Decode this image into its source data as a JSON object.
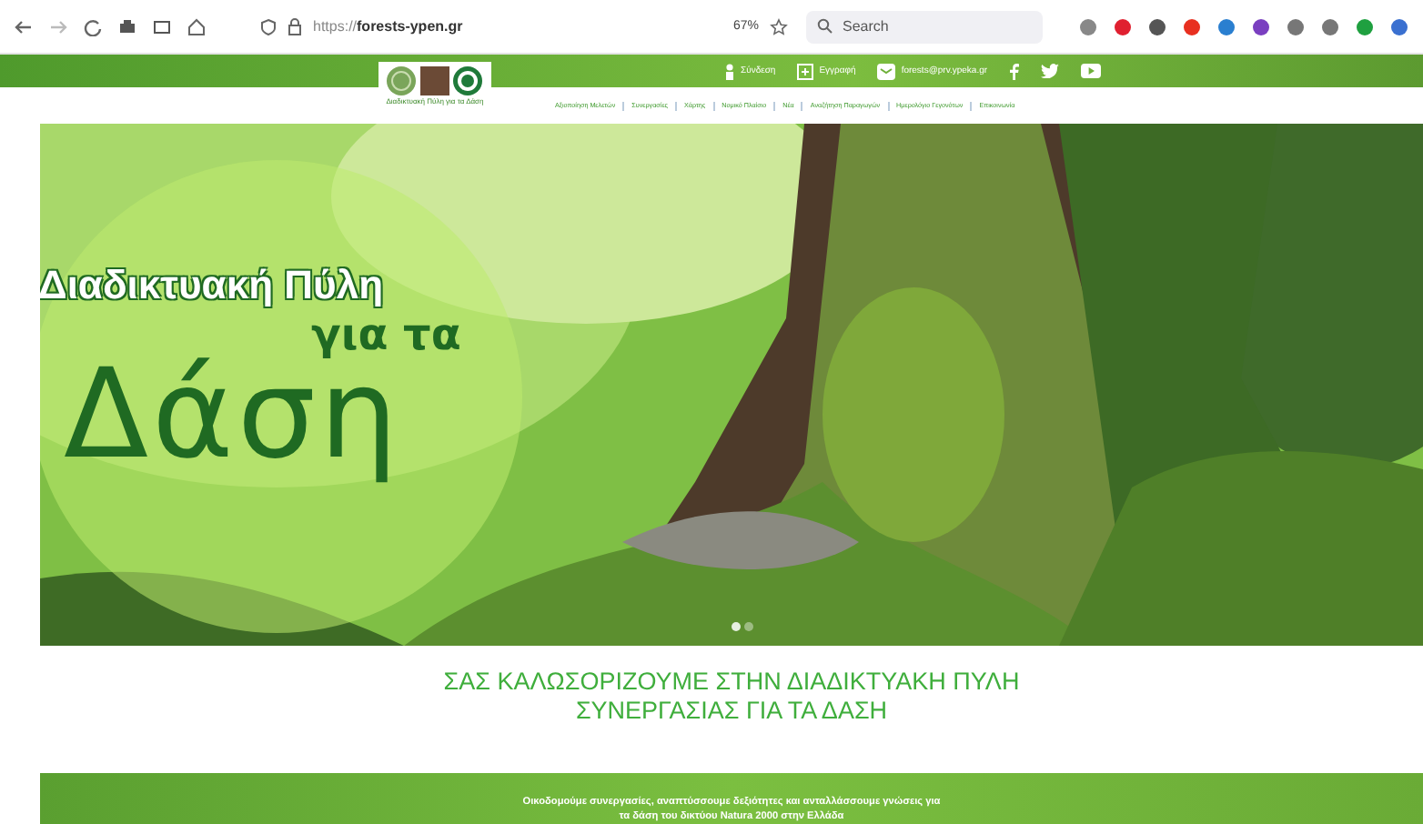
{
  "browser": {
    "url_prefix": "https://",
    "url_host": "forests-ypen.gr",
    "zoom": "67%",
    "search_placeholder": "Search"
  },
  "top_bar": {
    "links": [
      {
        "kind": "user",
        "label": "Σύνδεση"
      },
      {
        "kind": "plus",
        "label": "Εγγραφή"
      },
      {
        "kind": "mail",
        "label": "forests@prv.ypeka.gr"
      }
    ],
    "social": [
      {
        "kind": "facebook"
      },
      {
        "kind": "twitter"
      },
      {
        "kind": "youtube"
      }
    ]
  },
  "logo": {
    "caption": "Διαδικτυακή Πύλη για τα Δάση"
  },
  "nav": [
    "Αξιοποίηση Μελετών",
    "Συνεργασίες",
    "Χάρτης",
    "Νομικό Πλαίσιο",
    "Νέα",
    "Αναζήτηση Παραγωγών",
    "Ημερολόγιο Γεγονότων",
    "Επικοινωνία"
  ],
  "hero": {
    "line_1": "Διαδικτυακή Πύλη",
    "line_2": "για τα",
    "line_3": "Δάση",
    "slides": [
      {
        "selected": true
      },
      {
        "selected": false
      }
    ]
  },
  "welcome": {
    "line_1": "ΣΑΣ ΚΑΛΩΣΟΡΙΖΟΥΜΕ ΣΤΗΝ ΔΙΑΔΙΚΤΥΑΚΗ ΠΥΛΗ",
    "line_2": "ΣΥΝΕΡΓΑΣΙΑΣ ΓΙΑ ΤΑ ΔΑΣΗ"
  },
  "intro": "Οικοδομούμε συνεργασίες, αναπτύσσουμε δεξιότητες και ανταλλάσσουμε γνώσεις για τα δάση του δικτύου Natura 2000 στην Ελλάδα"
}
